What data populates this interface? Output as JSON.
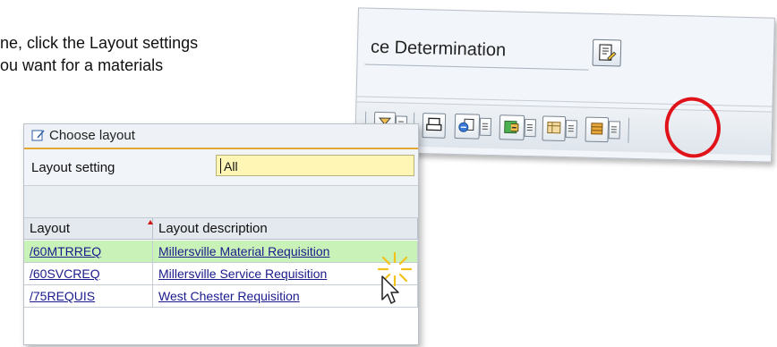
{
  "instruction": {
    "line1": "ne, click the Layout settings",
    "line2": "ou want for a materials"
  },
  "determination_window": {
    "title": "ce Determination",
    "icons": [
      "edit-document-icon"
    ],
    "toolbar_icons": [
      "filter-icon",
      "dropdown-arrow-icon",
      "print-icon",
      "export-icon",
      "local-file-icon",
      "layout-settings-icon"
    ]
  },
  "layout_dialog": {
    "title": "Choose layout",
    "layout_setting_label": "Layout setting",
    "layout_setting_value": "All",
    "columns": [
      "Layout",
      "Layout description"
    ],
    "rows": [
      {
        "layout": "/60MTRREQ",
        "description": "Millersville Material Requisition",
        "selected": true
      },
      {
        "layout": "/60SVCREQ",
        "description": "Millersville Service Requisition",
        "selected": false
      },
      {
        "layout": "/75REQUIS",
        "description": "West Chester Requisition",
        "selected": false
      }
    ]
  },
  "colors": {
    "highlight_circle": "#e0131a",
    "selected_row": "#c9f2b8",
    "input_background": "#fff6b5",
    "header_accent": "#e2a733"
  }
}
